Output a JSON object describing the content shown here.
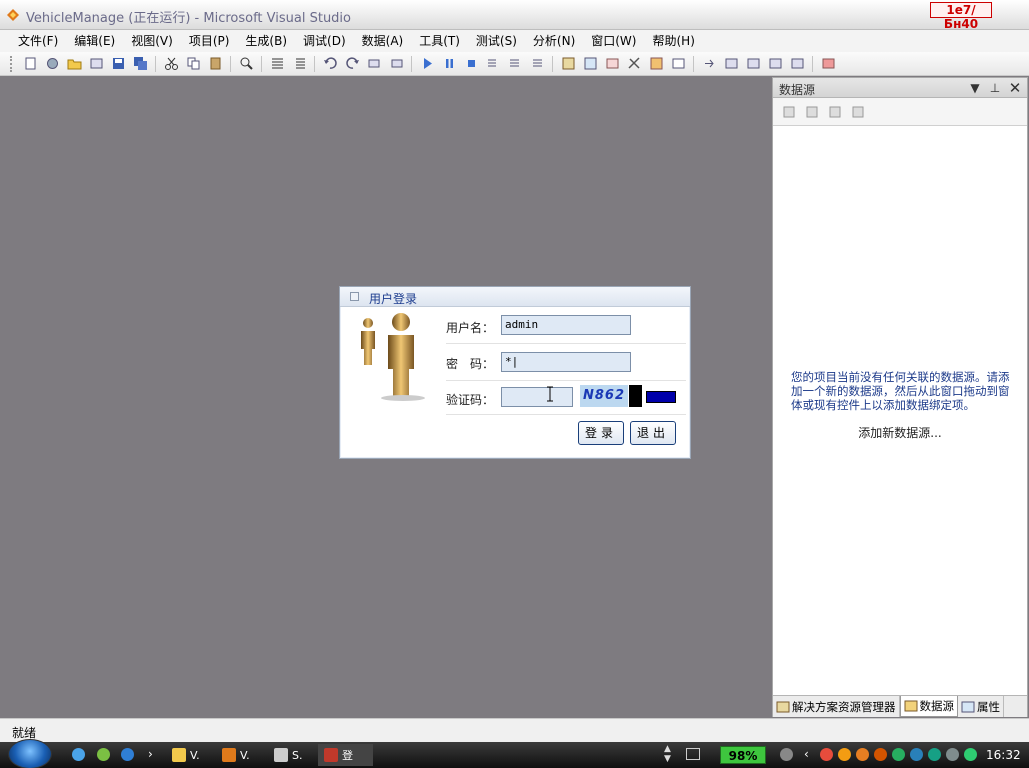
{
  "window": {
    "title": "VehicleManage (正在运行) - Microsoft Visual Studio",
    "badge": "1e7/Бн40"
  },
  "menu": [
    {
      "label": "文件(F)"
    },
    {
      "label": "编辑(E)"
    },
    {
      "label": "视图(V)"
    },
    {
      "label": "项目(P)"
    },
    {
      "label": "生成(B)"
    },
    {
      "label": "调试(D)"
    },
    {
      "label": "数据(A)"
    },
    {
      "label": "工具(T)"
    },
    {
      "label": "测试(S)"
    },
    {
      "label": "分析(N)"
    },
    {
      "label": "窗口(W)"
    },
    {
      "label": "帮助(H)"
    }
  ],
  "login": {
    "title": "用户登录",
    "username_label": "用户名：",
    "username_value": "admin",
    "password_label": "密　码：",
    "password_value": "*|",
    "captcha_label": "验证码：",
    "captcha_value": "",
    "captcha_text": "N862",
    "login_button": "登录",
    "exit_button": "退出"
  },
  "datasource": {
    "title": "数据源",
    "message": "您的项目当前没有任何关联的数据源。请添加一个新的数据源，然后从此窗口拖动到窗体或现有控件上以添加数据绑定项。",
    "add_link": "添加新数据源...",
    "tabs": [
      {
        "label": "解决方案资源管理器"
      },
      {
        "label": "数据源"
      },
      {
        "label": "属性"
      }
    ]
  },
  "status": {
    "text": "就绪"
  },
  "taskbar": {
    "apps": [
      {
        "label": "V."
      },
      {
        "label": "V."
      },
      {
        "label": "S."
      },
      {
        "label": "登"
      }
    ],
    "battery": "98%",
    "clock": "16:32"
  },
  "colors": {
    "workspace": "#7e7b80",
    "link": "#1d3d8f",
    "battery": "#3ec63e"
  }
}
